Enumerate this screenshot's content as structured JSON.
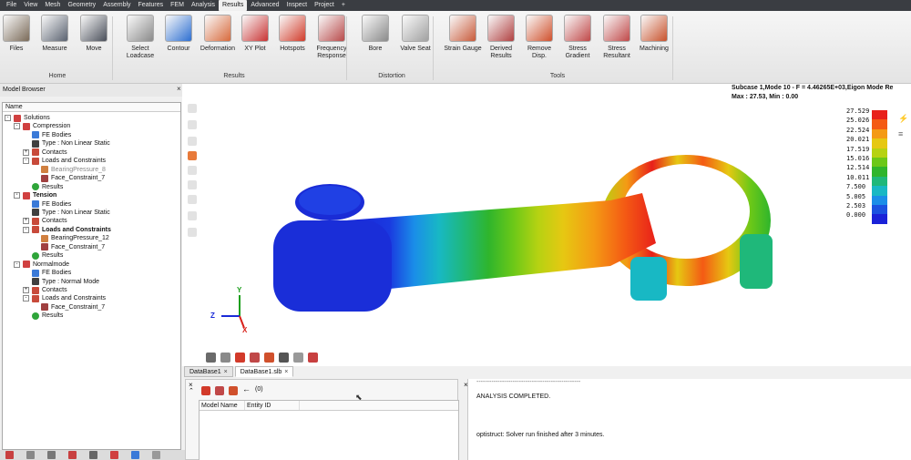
{
  "menubar": {
    "items": [
      "File",
      "View",
      "Mesh",
      "Geometry",
      "Assembly",
      "Features",
      "FEM",
      "Analysis",
      "Results",
      "Advanced",
      "Inspect",
      "Project"
    ],
    "active": "Results",
    "plus": "+"
  },
  "ribbon": {
    "buttons": [
      {
        "label": "Files",
        "icon": "folder-icon",
        "color": "#7a6a58"
      },
      {
        "label": "Measure",
        "icon": "measure-icon",
        "color": "#5a6270"
      },
      {
        "label": "Move",
        "icon": "move-icon",
        "color": "#4a4f5a"
      },
      {
        "label": "Select\nLoadcase",
        "icon": "select-loadcase-icon",
        "color": "#8a8a8a"
      },
      {
        "label": "Contour",
        "icon": "contour-icon",
        "color": "#2d6fd1"
      },
      {
        "label": "Deformation",
        "icon": "deformation-icon",
        "color": "#d86a3c"
      },
      {
        "label": "XY Plot",
        "icon": "xy-plot-icon",
        "color": "#c93434"
      },
      {
        "label": "Hotspots",
        "icon": "hotspots-icon",
        "color": "#d13b2a"
      },
      {
        "label": "Frequency\nResponse",
        "icon": "frequency-response-icon",
        "color": "#b84a4a"
      },
      {
        "label": "Bore",
        "icon": "bore-icon",
        "color": "#8a8a8a"
      },
      {
        "label": "Valve Seat",
        "icon": "valve-seat-icon",
        "color": "#a0a0a0"
      },
      {
        "label": "Strain Gauge",
        "icon": "strain-gauge-icon",
        "color": "#c85a3a"
      },
      {
        "label": "Derived\nResults",
        "icon": "derived-results-icon",
        "color": "#b04040"
      },
      {
        "label": "Remove\nDisp.",
        "icon": "remove-disp-icon",
        "color": "#d0502c"
      },
      {
        "label": "Stress\nGradient",
        "icon": "stress-gradient-icon",
        "color": "#c04848"
      },
      {
        "label": "Stress\nResultant",
        "icon": "stress-resultant-icon",
        "color": "#c04848"
      },
      {
        "label": "Machining",
        "icon": "machining-icon",
        "color": "#c8522c"
      }
    ],
    "groups": [
      "Home",
      "Results",
      "Distortion",
      "Tools"
    ]
  },
  "model_browser": {
    "title": "Model Browser",
    "column": "Name",
    "tree": [
      {
        "label": "Solutions",
        "level": 0,
        "exp": "-",
        "icon": "solutions-icon"
      },
      {
        "label": "Compression",
        "level": 1,
        "exp": "-",
        "icon": "solution-icon"
      },
      {
        "label": "FE Bodies",
        "level": 2,
        "exp": "",
        "icon": "fe-bodies-icon"
      },
      {
        "label": "Type : Non Linear Static",
        "level": 2,
        "exp": "",
        "icon": "type-icon"
      },
      {
        "label": "Contacts",
        "level": 2,
        "exp": "+",
        "icon": "contacts-icon"
      },
      {
        "label": "Loads and Constraints",
        "level": 2,
        "exp": "-",
        "icon": "loads-icon"
      },
      {
        "label": "BearingPressure_8",
        "level": 3,
        "exp": "",
        "icon": "pressure-icon",
        "gray": true
      },
      {
        "label": "Face_Constraint_7",
        "level": 3,
        "exp": "",
        "icon": "constraint-icon"
      },
      {
        "label": "Results",
        "level": 2,
        "exp": "",
        "icon": "results-icon"
      },
      {
        "label": "Tension",
        "level": 1,
        "exp": "-",
        "icon": "solution-icon",
        "bold": true
      },
      {
        "label": "FE Bodies",
        "level": 2,
        "exp": "",
        "icon": "fe-bodies-icon"
      },
      {
        "label": "Type : Non Linear Static",
        "level": 2,
        "exp": "",
        "icon": "type-icon"
      },
      {
        "label": "Contacts",
        "level": 2,
        "exp": "+",
        "icon": "contacts-icon"
      },
      {
        "label": "Loads and Constraints",
        "level": 2,
        "exp": "-",
        "icon": "loads-icon",
        "bold": true
      },
      {
        "label": "BearingPressure_12",
        "level": 3,
        "exp": "",
        "icon": "pressure-icon"
      },
      {
        "label": "Face_Constraint_7",
        "level": 3,
        "exp": "",
        "icon": "constraint-icon"
      },
      {
        "label": "Results",
        "level": 2,
        "exp": "",
        "icon": "results-icon"
      },
      {
        "label": "Normalmode",
        "level": 1,
        "exp": "-",
        "icon": "solution-icon"
      },
      {
        "label": "FE Bodies",
        "level": 2,
        "exp": "",
        "icon": "fe-bodies-icon"
      },
      {
        "label": "Type : Normal Mode",
        "level": 2,
        "exp": "",
        "icon": "type-icon"
      },
      {
        "label": "Contacts",
        "level": 2,
        "exp": "+",
        "icon": "contacts-icon"
      },
      {
        "label": "Loads and Constraints",
        "level": 2,
        "exp": "-",
        "icon": "loads-icon"
      },
      {
        "label": "Face_Constraint_7",
        "level": 3,
        "exp": "",
        "icon": "constraint-icon"
      },
      {
        "label": "Results",
        "level": 2,
        "exp": "",
        "icon": "results-icon"
      }
    ]
  },
  "viewport": {
    "title_line1": "Subcase 1,Mode 10 - F = 4.46265E+03,Eigon Mode Re",
    "title_line2": "Max : 27.53, Min : 0.00",
    "legend": {
      "values": [
        "27.529",
        "25.026",
        "22.524",
        "20.021",
        "17.519",
        "15.016",
        "12.514",
        "10.011",
        "7.500",
        "5.005",
        "2.503",
        "0.000"
      ],
      "colors": [
        "#e8201a",
        "#f45a14",
        "#f49a14",
        "#e6c812",
        "#b6d212",
        "#6cc818",
        "#2fb52c",
        "#1fb87a",
        "#18b8c4",
        "#1a8ee8",
        "#1a52e0",
        "#1a22d8"
      ]
    },
    "axes": {
      "x": "X",
      "y": "Y",
      "z": "Z"
    }
  },
  "tabs": [
    {
      "label": "DataBase1",
      "active": false
    },
    {
      "label": "DataBase1.slb",
      "active": true
    }
  ],
  "db_panel": {
    "filter_count": "(0)",
    "columns": [
      "Model Name",
      "Entity ID"
    ]
  },
  "output": {
    "dashes": "-------------------------------------------------",
    "line1": "ANALYSIS COMPLETED.",
    "line2": "optistruct:  Solver run finished after 3 minutes."
  },
  "close_glyph": "×"
}
